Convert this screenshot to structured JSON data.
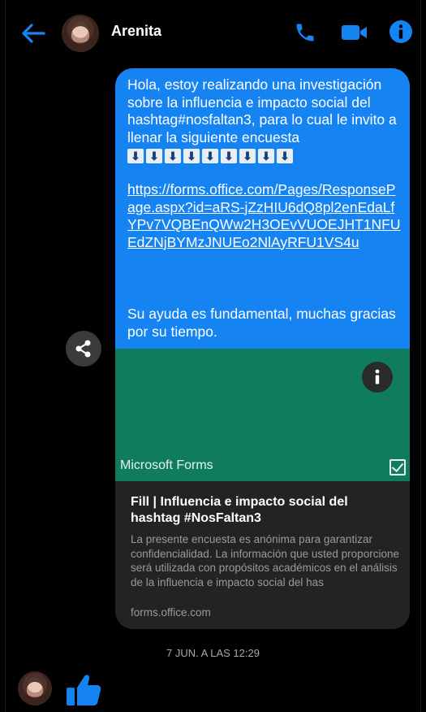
{
  "header": {
    "contact_name": "Arenita"
  },
  "message": {
    "intro": "Hola, estoy realizando una investigación sobre la influencia e impacto social del hashtag#nosfaltan3, para lo cual le invito a llenar la siguiente encuesta",
    "arrow_glyph": "⬇",
    "arrow_count": 9,
    "link": "https://forms.office.com/Pages/ResponsePage.aspx?id=aRS-jZzHIU6dQ8pl2enEdaLfYPv7VQBEnQWw2H3OEvVUOEJHT1NFUEdZNjBYMzJNUEo2NlAyRFU1VS4u",
    "closing": "Su ayuda es fundamental, muchas gracias por su tiempo."
  },
  "preview": {
    "app_name": "Microsoft Forms",
    "title": "Fill | Influencia e impacto social del hashtag #NosFaltan3",
    "description": "La presente encuesta es anónima para garantizar confidencialidad. La información que usted proporcione será utilizada con propósitos académicos en el análisis de la influencia e impacto social del has",
    "domain": "forms.office.com"
  },
  "timestamp": "7 JUN. A LAS 12:29",
  "colors": {
    "accent": "#1683f2",
    "bubble": "#1683f2",
    "forms_green": "#107c5e",
    "background": "#000000"
  },
  "icons": {
    "back": "arrow-left-icon",
    "call": "phone-icon",
    "video": "video-camera-icon",
    "info": "info-icon",
    "share": "share-icon",
    "like": "thumbs-up-icon"
  }
}
